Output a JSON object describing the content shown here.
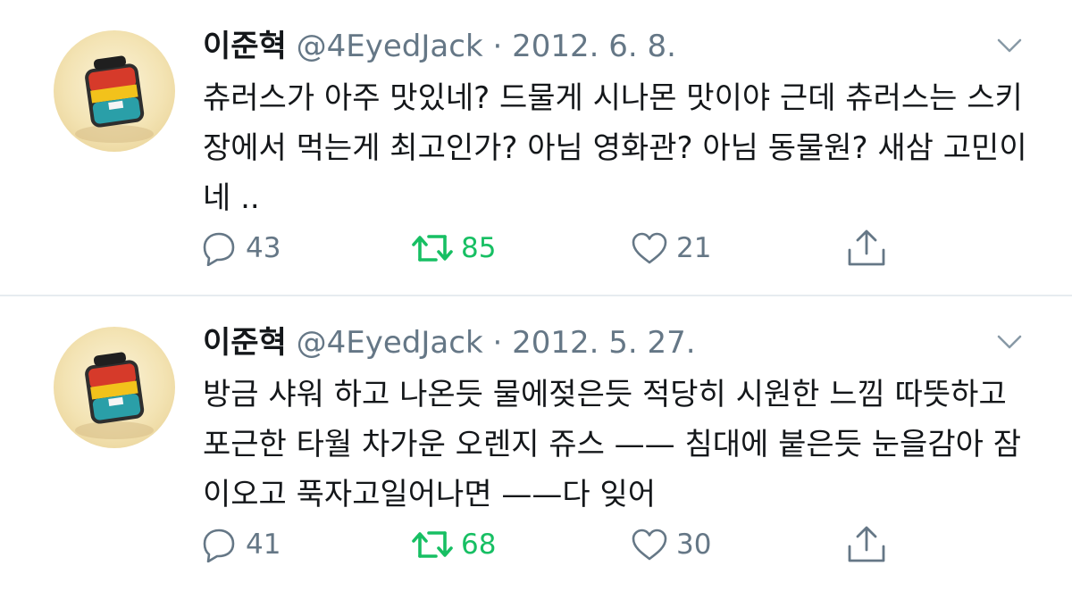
{
  "tweets": [
    {
      "name": "이준혁",
      "handle": "@4EyedJack",
      "separator": "·",
      "date": "2012. 6. 8.",
      "text": "츄러스가 아주 맛있네? 드물게 시나몬 맛이야 근데 츄러스는 스키장에서 먹는게 최고인가? 아님 영화관? 아님 동물원? 새삼 고민이네 ..",
      "replies": "43",
      "retweets": "85",
      "likes": "21"
    },
    {
      "name": "이준혁",
      "handle": "@4EyedJack",
      "separator": "·",
      "date": "2012. 5. 27.",
      "text": "방금 샤워 하고 나온듯 물에젖은듯 적당히 시원한 느낌 따뜻하고 포근한 타월 차가운 오렌지 쥬스 —— 침대에 붙은듯 눈을감아 잠이오고 푹자고일어나면 ——다 잊어",
      "replies": "41",
      "retweets": "68",
      "likes": "30"
    }
  ],
  "icons": {
    "reply": "reply-icon",
    "retweet": "retweet-icon",
    "like": "heart-icon",
    "share": "share-icon",
    "more": "chevron-down-icon"
  },
  "colors": {
    "text": "#14171a",
    "secondary": "#657786",
    "retweet_active": "#17bf63",
    "divider": "#e6ecf0"
  }
}
